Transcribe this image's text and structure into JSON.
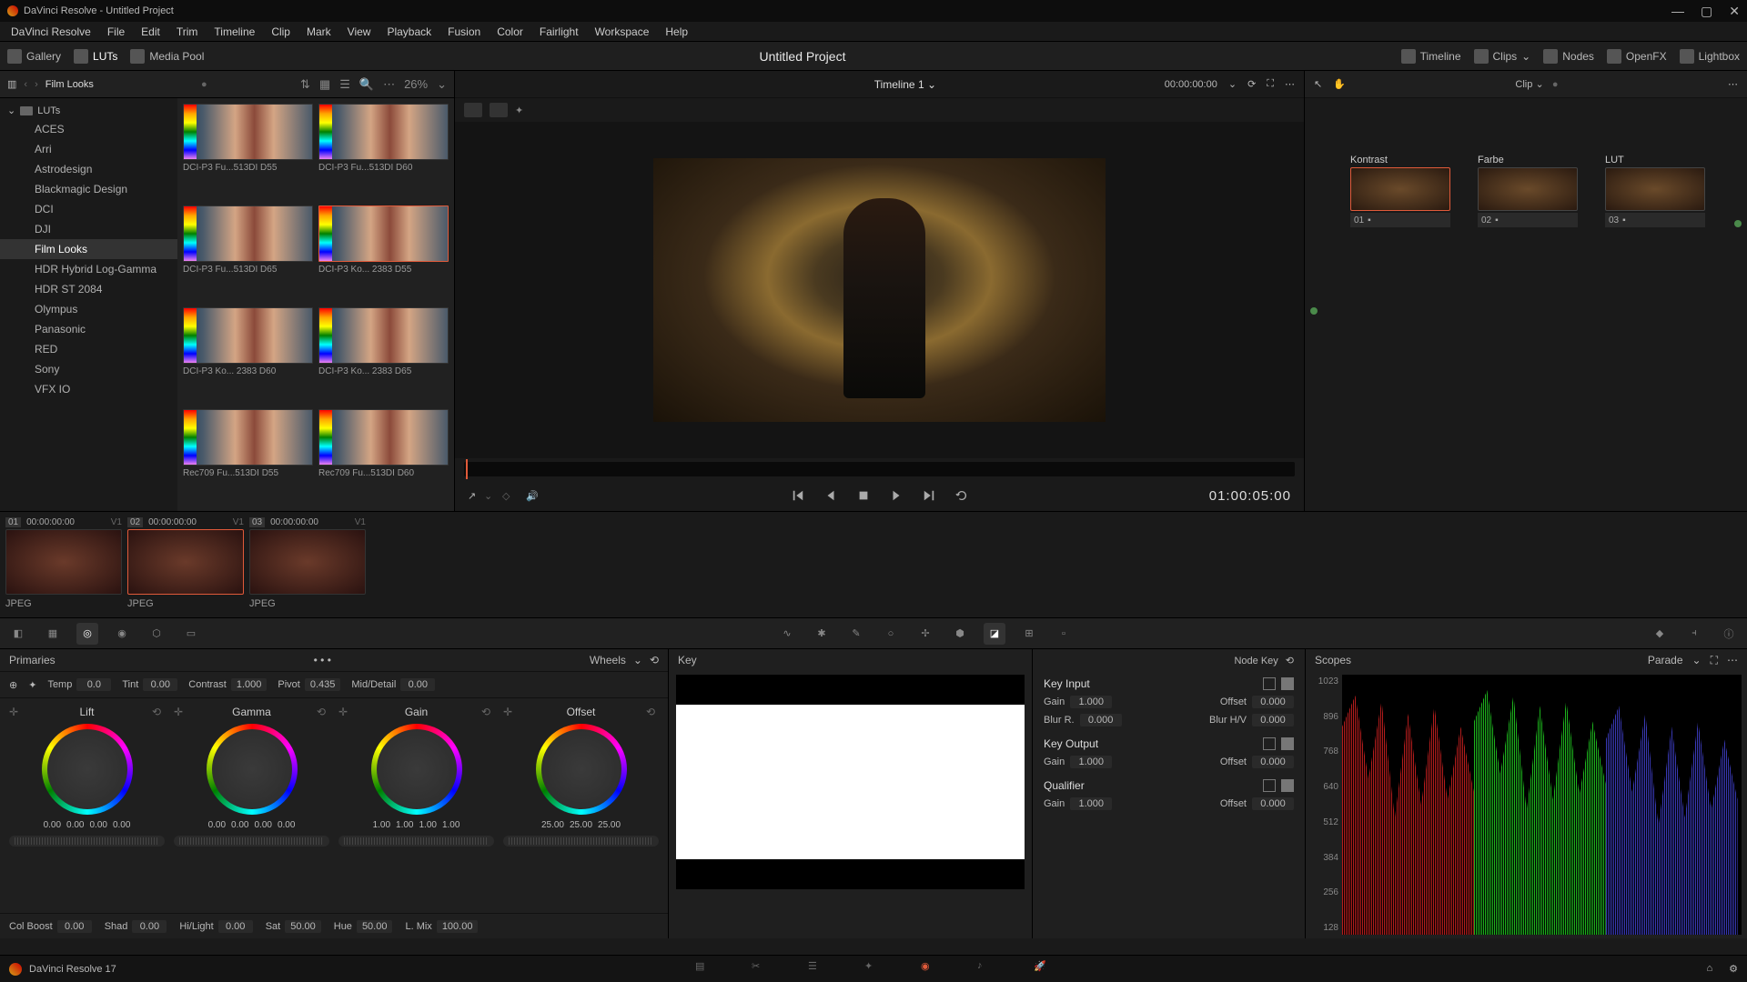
{
  "window": {
    "title": "DaVinci Resolve - Untitled Project"
  },
  "menus": [
    "DaVinci Resolve",
    "File",
    "Edit",
    "Trim",
    "Timeline",
    "Clip",
    "Mark",
    "View",
    "Playback",
    "Fusion",
    "Color",
    "Fairlight",
    "Workspace",
    "Help"
  ],
  "toolbar": {
    "left": [
      {
        "label": "Gallery",
        "icon": "gallery-icon",
        "active": false
      },
      {
        "label": "LUTs",
        "icon": "luts-icon",
        "active": true
      },
      {
        "label": "Media Pool",
        "icon": "mediapool-icon",
        "active": false
      }
    ],
    "project_title": "Untitled Project",
    "right": [
      {
        "label": "Timeline",
        "icon": "timeline-icon"
      },
      {
        "label": "Clips",
        "icon": "clips-icon",
        "dropdown": true
      },
      {
        "label": "Nodes",
        "icon": "nodes-icon"
      },
      {
        "label": "OpenFX",
        "icon": "openfx-icon"
      },
      {
        "label": "Lightbox",
        "icon": "lightbox-icon"
      }
    ]
  },
  "luts_panel": {
    "title": "Film Looks",
    "zoom": "26%",
    "root": "LUTs",
    "tree": [
      "ACES",
      "Arri",
      "Astrodesign",
      "Blackmagic Design",
      "DCI",
      "DJI",
      "Film Looks",
      "HDR Hybrid Log-Gamma",
      "HDR ST 2084",
      "Olympus",
      "Panasonic",
      "RED",
      "Sony",
      "VFX IO"
    ],
    "selected": "Film Looks",
    "grid": [
      {
        "label": "DCI-P3 Fu...513DI D55"
      },
      {
        "label": "DCI-P3 Fu...513DI D60"
      },
      {
        "label": "DCI-P3 Fu...513DI D65"
      },
      {
        "label": "DCI-P3 Ko... 2383 D55",
        "selected": true
      },
      {
        "label": "DCI-P3 Ko... 2383 D60"
      },
      {
        "label": "DCI-P3 Ko... 2383 D65"
      },
      {
        "label": "Rec709 Fu...513DI D55"
      },
      {
        "label": "Rec709 Fu...513DI D60"
      }
    ]
  },
  "viewer": {
    "timeline_name": "Timeline 1",
    "timecode_src": "00:00:00:00",
    "timecode": "01:00:05:00"
  },
  "nodes_panel": {
    "mode": "Clip",
    "nodes": [
      {
        "num": "01",
        "label": "Kontrast",
        "selected": true
      },
      {
        "num": "02",
        "label": "Farbe"
      },
      {
        "num": "03",
        "label": "LUT"
      }
    ]
  },
  "clips": [
    {
      "num": "01",
      "tc": "00:00:00:00",
      "ver": "V1",
      "fmt": "JPEG"
    },
    {
      "num": "02",
      "tc": "00:00:00:00",
      "ver": "V1",
      "fmt": "JPEG",
      "selected": true
    },
    {
      "num": "03",
      "tc": "00:00:00:00",
      "ver": "V1",
      "fmt": "JPEG"
    }
  ],
  "primaries": {
    "title": "Primaries",
    "mode": "Wheels",
    "adjust": [
      {
        "label": "Temp",
        "value": "0.0"
      },
      {
        "label": "Tint",
        "value": "0.00"
      },
      {
        "label": "Contrast",
        "value": "1.000"
      },
      {
        "label": "Pivot",
        "value": "0.435"
      },
      {
        "label": "Mid/Detail",
        "value": "0.00"
      }
    ],
    "wheels": [
      {
        "name": "Lift",
        "vals": [
          "0.00",
          "0.00",
          "0.00",
          "0.00"
        ]
      },
      {
        "name": "Gamma",
        "vals": [
          "0.00",
          "0.00",
          "0.00",
          "0.00"
        ]
      },
      {
        "name": "Gain",
        "vals": [
          "1.00",
          "1.00",
          "1.00",
          "1.00"
        ]
      },
      {
        "name": "Offset",
        "vals": [
          "25.00",
          "25.00",
          "25.00"
        ]
      }
    ],
    "footer": [
      {
        "label": "Col Boost",
        "value": "0.00"
      },
      {
        "label": "Shad",
        "value": "0.00"
      },
      {
        "label": "Hi/Light",
        "value": "0.00"
      },
      {
        "label": "Sat",
        "value": "50.00"
      },
      {
        "label": "Hue",
        "value": "50.00"
      },
      {
        "label": "L. Mix",
        "value": "100.00"
      }
    ]
  },
  "key_panel": {
    "title": "Key",
    "subtitle": "Node Key",
    "sections": [
      {
        "name": "Key Input",
        "rows": [
          {
            "l1": "Gain",
            "v1": "1.000",
            "l2": "Offset",
            "v2": "0.000"
          },
          {
            "l1": "Blur R.",
            "v1": "0.000",
            "l2": "Blur H/V",
            "v2": "0.000"
          }
        ]
      },
      {
        "name": "Key Output",
        "rows": [
          {
            "l1": "Gain",
            "v1": "1.000",
            "l2": "Offset",
            "v2": "0.000"
          }
        ]
      },
      {
        "name": "Qualifier",
        "rows": [
          {
            "l1": "Gain",
            "v1": "1.000",
            "l2": "Offset",
            "v2": "0.000"
          }
        ]
      }
    ]
  },
  "scopes": {
    "title": "Scopes",
    "mode": "Parade",
    "scale": [
      "1023",
      "896",
      "768",
      "640",
      "512",
      "384",
      "256",
      "128"
    ]
  },
  "status": {
    "app": "DaVinci Resolve 17"
  }
}
